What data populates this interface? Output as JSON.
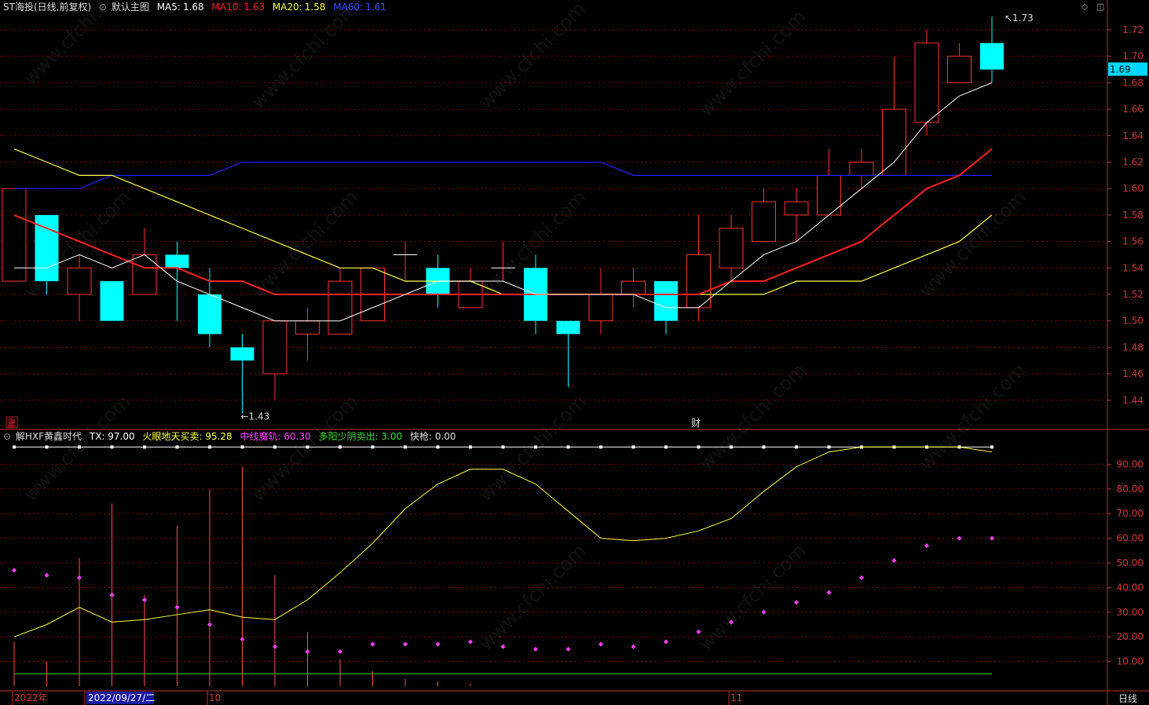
{
  "header_main": {
    "title": "ST海投(日线,前复权)",
    "template": "默认主图",
    "ma5_label": "MA5:",
    "ma5": "1.68",
    "ma10_label": "MA10:",
    "ma10": "1.63",
    "ma20_label": "MA20:",
    "ma20": "1.58",
    "ma60_label": "MA60:",
    "ma60": "1.61"
  },
  "header_ind": {
    "name": "解HXF黄鑫时代",
    "tx": "TX: 97.00",
    "fire": "火眼地天买卖: 95.28",
    "mid": "中线魔轨: 60.30",
    "sell": "多阳少阴卖出: 3.00",
    "fast": "快枪: 0.00"
  },
  "colors": {
    "up": "#ff3232",
    "down": "#00ffff",
    "ma5": "#ffffff",
    "ma10": "#ff2020",
    "ma20": "#ffff40",
    "ma60": "#2020ff",
    "grid": "#7a0000",
    "axis": "#c03030",
    "magenta": "#ff40ff",
    "green": "#33cc33"
  },
  "badges": {
    "zhang": "涨",
    "cai": "财",
    "current_price": "1.69",
    "period": "日线"
  },
  "markers": {
    "high": "1.73",
    "low": "1.43"
  },
  "x_labels": {
    "year": "2022年",
    "date": "2022/09/27/二",
    "oct": "10",
    "nov": "11"
  },
  "watermark": "www.cfchi.com",
  "chart_data": {
    "type": "candlestick",
    "price_axis": {
      "min": 1.44,
      "max": 1.72,
      "step": 0.02
    },
    "price_ticks": [
      "1.72",
      "1.70",
      "1.68",
      "1.66",
      "1.64",
      "1.62",
      "1.60",
      "1.58",
      "1.56",
      "1.54",
      "1.52",
      "1.50",
      "1.48",
      "1.46",
      "1.44"
    ],
    "candles": [
      {
        "o": 1.53,
        "h": 1.6,
        "l": 1.53,
        "c": 1.6
      },
      {
        "o": 1.58,
        "h": 1.58,
        "l": 1.52,
        "c": 1.53
      },
      {
        "o": 1.52,
        "h": 1.55,
        "l": 1.5,
        "c": 1.54
      },
      {
        "o": 1.53,
        "h": 1.53,
        "l": 1.5,
        "c": 1.5
      },
      {
        "o": 1.52,
        "h": 1.57,
        "l": 1.52,
        "c": 1.55
      },
      {
        "o": 1.55,
        "h": 1.56,
        "l": 1.5,
        "c": 1.54
      },
      {
        "o": 1.52,
        "h": 1.54,
        "l": 1.48,
        "c": 1.49
      },
      {
        "o": 1.48,
        "h": 1.49,
        "l": 1.43,
        "c": 1.47
      },
      {
        "o": 1.46,
        "h": 1.5,
        "l": 1.44,
        "c": 1.5
      },
      {
        "o": 1.49,
        "h": 1.51,
        "l": 1.47,
        "c": 1.5
      },
      {
        "o": 1.49,
        "h": 1.54,
        "l": 1.49,
        "c": 1.53
      },
      {
        "o": 1.5,
        "h": 1.54,
        "l": 1.5,
        "c": 1.54
      },
      {
        "o": 1.55,
        "h": 1.56,
        "l": 1.53,
        "c": 1.55
      },
      {
        "o": 1.54,
        "h": 1.55,
        "l": 1.51,
        "c": 1.52
      },
      {
        "o": 1.51,
        "h": 1.54,
        "l": 1.51,
        "c": 1.53
      },
      {
        "o": 1.54,
        "h": 1.56,
        "l": 1.53,
        "c": 1.54
      },
      {
        "o": 1.54,
        "h": 1.55,
        "l": 1.49,
        "c": 1.5
      },
      {
        "o": 1.5,
        "h": 1.5,
        "l": 1.45,
        "c": 1.49
      },
      {
        "o": 1.5,
        "h": 1.54,
        "l": 1.49,
        "c": 1.52
      },
      {
        "o": 1.52,
        "h": 1.54,
        "l": 1.51,
        "c": 1.53
      },
      {
        "o": 1.53,
        "h": 1.53,
        "l": 1.49,
        "c": 1.5
      },
      {
        "o": 1.51,
        "h": 1.58,
        "l": 1.5,
        "c": 1.55
      },
      {
        "o": 1.54,
        "h": 1.58,
        "l": 1.53,
        "c": 1.57
      },
      {
        "o": 1.56,
        "h": 1.6,
        "l": 1.56,
        "c": 1.59
      },
      {
        "o": 1.58,
        "h": 1.6,
        "l": 1.56,
        "c": 1.59
      },
      {
        "o": 1.58,
        "h": 1.63,
        "l": 1.58,
        "c": 1.61
      },
      {
        "o": 1.61,
        "h": 1.63,
        "l": 1.6,
        "c": 1.62
      },
      {
        "o": 1.61,
        "h": 1.7,
        "l": 1.61,
        "c": 1.66
      },
      {
        "o": 1.65,
        "h": 1.72,
        "l": 1.64,
        "c": 1.71
      },
      {
        "o": 1.68,
        "h": 1.71,
        "l": 1.68,
        "c": 1.7
      },
      {
        "o": 1.71,
        "h": 1.73,
        "l": 1.68,
        "c": 1.69
      }
    ],
    "ma5": [
      1.54,
      1.54,
      1.55,
      1.54,
      1.55,
      1.53,
      1.52,
      1.51,
      1.5,
      1.5,
      1.5,
      1.51,
      1.52,
      1.53,
      1.53,
      1.53,
      1.52,
      1.52,
      1.52,
      1.52,
      1.51,
      1.51,
      1.53,
      1.55,
      1.56,
      1.58,
      1.6,
      1.62,
      1.65,
      1.67,
      1.68
    ],
    "ma10": [
      1.58,
      1.57,
      1.56,
      1.55,
      1.54,
      1.54,
      1.53,
      1.53,
      1.52,
      1.52,
      1.52,
      1.52,
      1.52,
      1.52,
      1.52,
      1.52,
      1.52,
      1.52,
      1.52,
      1.52,
      1.52,
      1.52,
      1.53,
      1.53,
      1.54,
      1.55,
      1.56,
      1.58,
      1.6,
      1.61,
      1.63
    ],
    "ma20": [
      1.63,
      1.62,
      1.61,
      1.61,
      1.6,
      1.59,
      1.58,
      1.57,
      1.56,
      1.55,
      1.54,
      1.54,
      1.53,
      1.53,
      1.53,
      1.52,
      1.52,
      1.52,
      1.52,
      1.52,
      1.52,
      1.52,
      1.52,
      1.52,
      1.53,
      1.53,
      1.53,
      1.54,
      1.55,
      1.56,
      1.58
    ],
    "ma60": [
      1.6,
      1.6,
      1.6,
      1.61,
      1.61,
      1.61,
      1.61,
      1.62,
      1.62,
      1.62,
      1.62,
      1.62,
      1.62,
      1.62,
      1.62,
      1.62,
      1.62,
      1.62,
      1.62,
      1.61,
      1.61,
      1.61,
      1.61,
      1.61,
      1.61,
      1.61,
      1.61,
      1.61,
      1.61,
      1.61,
      1.61
    ],
    "ma60_start": [
      1.6
    ],
    "indicator": {
      "axis": {
        "min": 0,
        "max": 100
      },
      "ticks": [
        "90.00",
        "80.00",
        "70.00",
        "60.00",
        "50.00",
        "40.00",
        "30.00",
        "20.00",
        "10.00"
      ],
      "tx": [
        97,
        97,
        97,
        97,
        97,
        97,
        97,
        97,
        97,
        97,
        97,
        97,
        97,
        97,
        97,
        97,
        97,
        97,
        97,
        97,
        97,
        97,
        97,
        97,
        97,
        97,
        97,
        97,
        97,
        97,
        97
      ],
      "fire": [
        20,
        25,
        32,
        26,
        27,
        29,
        31,
        28,
        27,
        35,
        46,
        58,
        72,
        82,
        88,
        88,
        82,
        71,
        60,
        59,
        60,
        63,
        68,
        79,
        89,
        95,
        97,
        97,
        97,
        97,
        95
      ],
      "mid": [
        47,
        45,
        44,
        37,
        35,
        32,
        25,
        19,
        16,
        14,
        14,
        17,
        17,
        17,
        18,
        16,
        15,
        15,
        17,
        16,
        18,
        22,
        26,
        30,
        34,
        38,
        44,
        51,
        57,
        60,
        60
      ],
      "bars": [
        18,
        10,
        52,
        74,
        37,
        65,
        80,
        89,
        45,
        22,
        11,
        6,
        3,
        2,
        1,
        0,
        0,
        0,
        0,
        0,
        0,
        0,
        0,
        0,
        0,
        0,
        0,
        0,
        0,
        0,
        0
      ],
      "green_level": 5
    }
  }
}
